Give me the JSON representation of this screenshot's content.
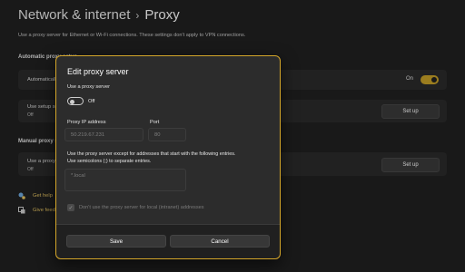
{
  "header": {
    "parent": "Network & internet",
    "separator": "›",
    "current": "Proxy",
    "description": "Use a proxy server for Ethernet or Wi-Fi connections. These settings don't apply to VPN connections."
  },
  "automatic": {
    "heading": "Automatic proxy setup",
    "auto_detect_label": "Automatically detect settings",
    "auto_detect_state": "On",
    "setup_script_label": "Use setup script",
    "setup_script_state": "Off",
    "setup_button": "Set up"
  },
  "manual": {
    "heading": "Manual proxy setup",
    "use_proxy_label": "Use a proxy server",
    "use_proxy_state": "Off",
    "setup_button": "Set up"
  },
  "links": {
    "get_help": "Get help",
    "give_feedback": "Give feedback"
  },
  "dialog": {
    "title": "Edit proxy server",
    "use_proxy_label": "Use a proxy server",
    "toggle_state": "Off",
    "ip_label": "Proxy IP address",
    "ip_value": "50.219.67.231",
    "port_label": "Port",
    "port_value": "80",
    "exceptions_line1": "Use the proxy server except for addresses that start with the following entries.",
    "exceptions_line2": "Use semicolons (;) to separate entries.",
    "exceptions_value": "*.local",
    "local_checkbox_label": "Don't use the proxy server for local (intranet) addresses",
    "save_button": "Save",
    "cancel_button": "Cancel"
  },
  "colors": {
    "accent": "#c7a028",
    "dialog_border": "#d4a62a",
    "background": "#202020"
  },
  "icons": [
    "help-icon",
    "feedback-icon",
    "toggle-knob",
    "checkmark-icon"
  ]
}
